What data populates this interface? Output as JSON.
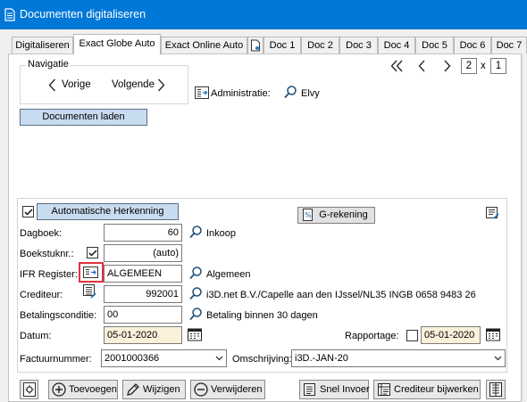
{
  "window": {
    "title": "Documenten digitaliseren"
  },
  "tabs": [
    {
      "label": "Digitaliseren"
    },
    {
      "label": "Exact Globe Auto"
    },
    {
      "label": "Exact Online Auto"
    },
    {
      "label": "Doc 1"
    },
    {
      "label": "Doc 2"
    },
    {
      "label": "Doc 3"
    },
    {
      "label": "Doc 4"
    },
    {
      "label": "Doc 5"
    },
    {
      "label": "Doc 6"
    },
    {
      "label": "Doc 7"
    }
  ],
  "navigation": {
    "legend": "Navigatie",
    "prev_label": "Vorige",
    "next_label": "Volgende"
  },
  "paging": {
    "current": "2",
    "separator": "x",
    "total": "1"
  },
  "administratie": {
    "label": "Administratie:",
    "value": "Elvy"
  },
  "load_button": "Documenten laden",
  "recognition": {
    "checked": true,
    "auto_button": "Automatische Herkenning",
    "grekening_button": "G-rekening"
  },
  "form": {
    "dagboek": {
      "label": "Dagboek:",
      "value": "60",
      "description": "Inkoop"
    },
    "boekstuknr": {
      "label": "Boekstuknr.:",
      "value": "(auto)",
      "checked": true
    },
    "ifr_register": {
      "label": "IFR Register:",
      "value": "ALGEMEEN",
      "description": "Algemeen"
    },
    "crediteur": {
      "label": "Crediteur:",
      "value": "992001",
      "description": "i3D.net B.V./Capelle aan den IJssel/NL35 INGB 0658 9483 26"
    },
    "betalingsconditie": {
      "label": "Betalingsconditie:",
      "value": "00",
      "description": "Betaling binnen 30 dagen"
    },
    "datum": {
      "label": "Datum:",
      "value": "05-01-2020"
    },
    "rapportage": {
      "label": "Rapportage:",
      "value": "05-01-2020",
      "checked": false
    },
    "factuurnummer": {
      "label": "Factuurnummer:",
      "value": "2001000366"
    },
    "omschrijving": {
      "label": "Omschrijving:",
      "value": "i3D.-JAN-20"
    }
  },
  "toolbar": {
    "add": "Toevoegen",
    "edit": "Wijzigen",
    "delete": "Verwijderen",
    "quick_entry": "Snel Invoer",
    "edit_creditor": "Crediteur bijwerken"
  },
  "colors": {
    "titlebar": "#0078d7",
    "accent_button": "#c8dcef",
    "date_field": "#fbf0d9",
    "highlight": "#e0333a"
  }
}
